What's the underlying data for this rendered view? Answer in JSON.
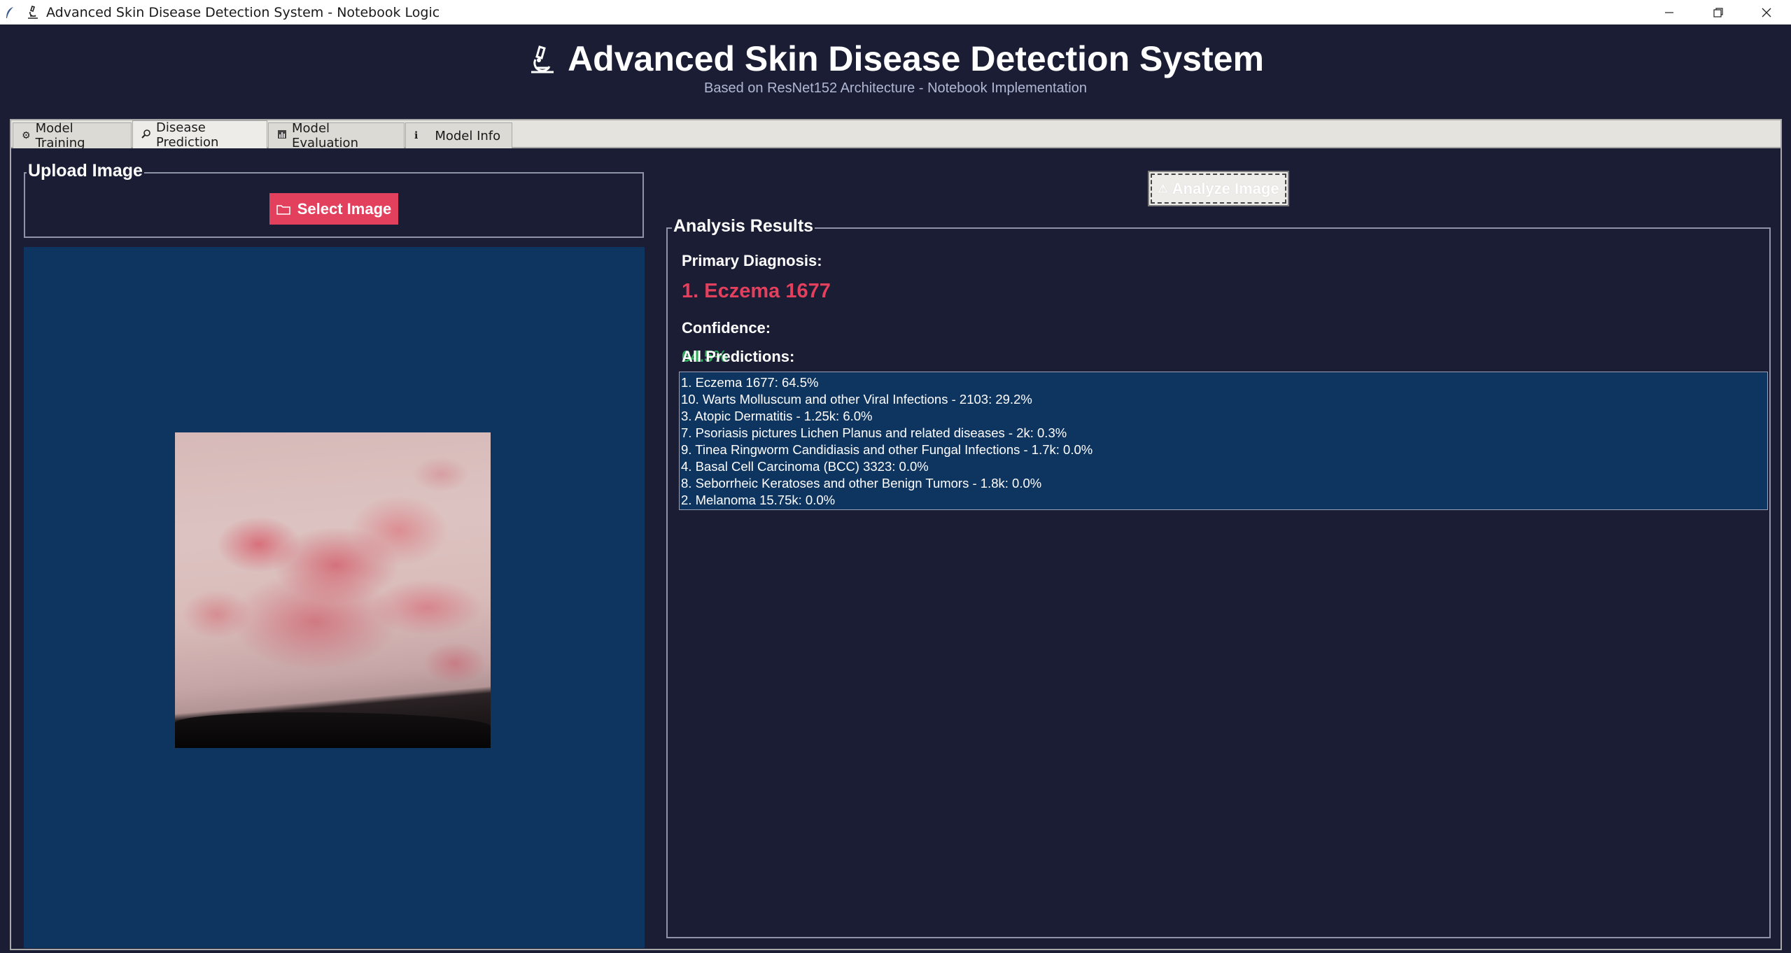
{
  "window": {
    "title": "Advanced Skin Disease Detection System - Notebook Logic",
    "controls": [
      "minimize",
      "maximize",
      "close"
    ]
  },
  "header": {
    "title": "Advanced Skin Disease Detection System",
    "subtitle": "Based on ResNet152 Architecture - Notebook Implementation",
    "icon": "microscope-icon"
  },
  "tabs": [
    {
      "label": "Model Training",
      "icon": "gear-icon",
      "active": false
    },
    {
      "label": "Disease Prediction",
      "icon": "search-icon",
      "active": true
    },
    {
      "label": "Model Evaluation",
      "icon": "chart-icon",
      "active": false
    },
    {
      "label": "Model Info",
      "icon": "info-icon",
      "active": false
    }
  ],
  "upload": {
    "legend": "Upload Image",
    "select_button": "Select Image"
  },
  "analyze_button": "Analyze Image",
  "results": {
    "legend": "Analysis Results",
    "primary_label": "Primary Diagnosis:",
    "primary_value": "1. Eczema 1677",
    "confidence_label": "Confidence:",
    "confidence_value": "64.5%",
    "all_label": "All Predictions:",
    "predictions": [
      "1. Eczema 1677: 64.5%",
      "10. Warts Molluscum and other Viral Infections - 2103: 29.2%",
      "3. Atopic Dermatitis - 1.25k: 6.0%",
      "7. Psoriasis pictures Lichen Planus and related diseases - 2k: 0.3%",
      "9. Tinea Ringworm Candidiasis and other Fungal Infections - 1.7k: 0.0%",
      "4. Basal Cell Carcinoma (BCC) 3323: 0.0%",
      "8. Seborrheic Keratoses and other Benign Tumors - 1.8k: 0.0%",
      "2. Melanoma 15.75k: 0.0%"
    ]
  },
  "colors": {
    "background": "#1a1d33",
    "panel": "#0e3460",
    "accent": "#e3405e",
    "confidence": "#2eab5a"
  }
}
